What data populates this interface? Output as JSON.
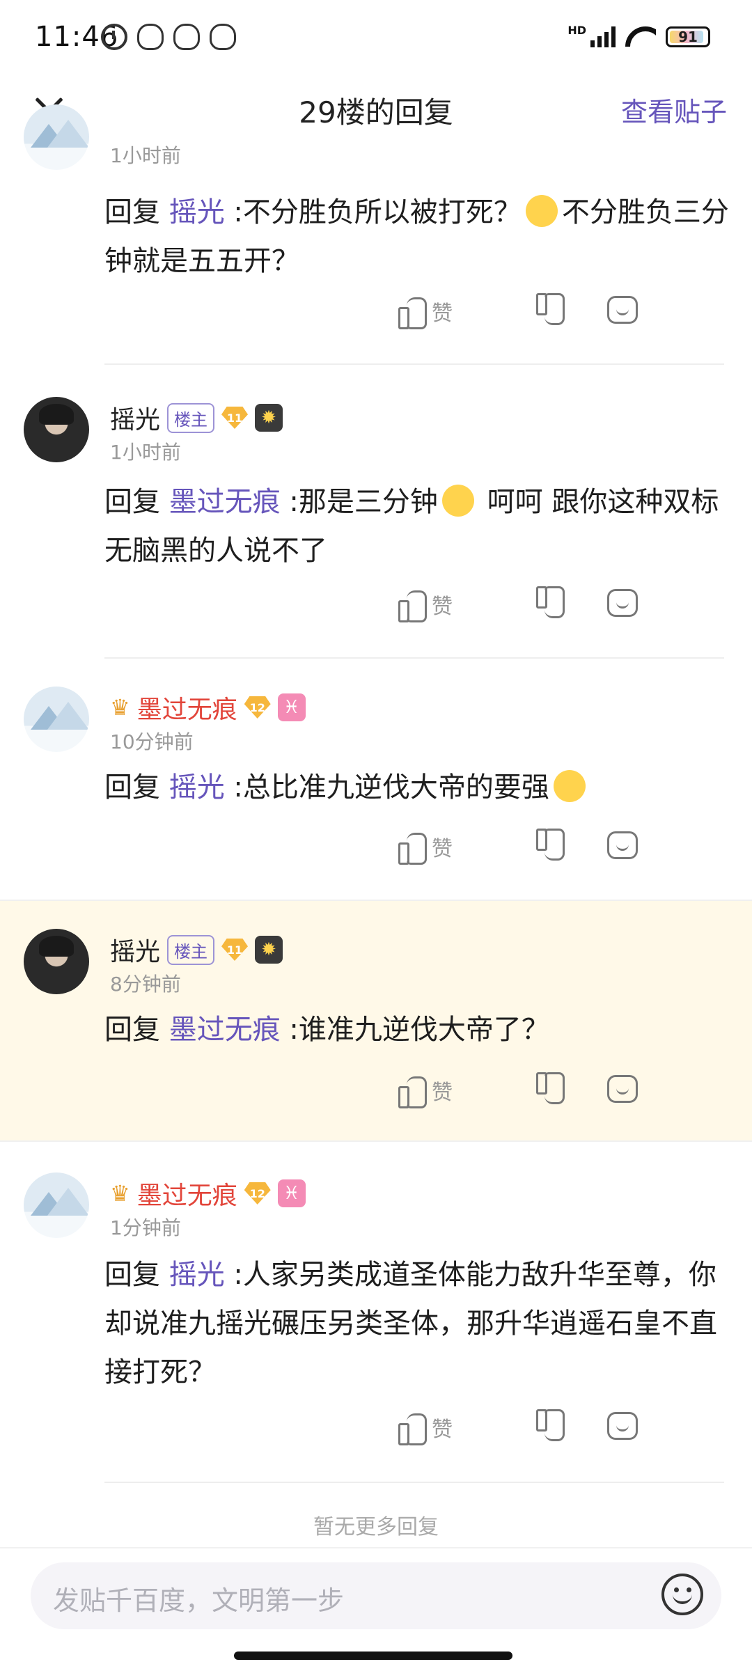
{
  "status_bar": {
    "time": "11:46",
    "network": "HD",
    "battery": "91"
  },
  "header": {
    "title": "29楼的回复",
    "view_post": "查看贴子"
  },
  "replies": [
    {
      "time": "1小时前",
      "prefix": "回复",
      "mention": "摇光",
      "text_a": " :不分胜负所以被打死？",
      "text_b": "不分胜负三分钟就是五五开？",
      "like": "赞"
    },
    {
      "name": "摇光",
      "role": "楼主",
      "level": "11",
      "time": "1小时前",
      "prefix": "回复",
      "mention": "墨过无痕",
      "text_a": " :那是三分钟",
      "text_b": " 呵呵 跟你这种双标无脑黑的人说不了",
      "like": "赞"
    },
    {
      "name": "墨过无痕",
      "level": "12",
      "time": "10分钟前",
      "prefix": "回复",
      "mention": "摇光",
      "text_a": " :总比准九逆伐大帝的要强",
      "like": "赞"
    },
    {
      "name": "摇光",
      "role": "楼主",
      "level": "11",
      "time": "8分钟前",
      "prefix": "回复",
      "mention": "墨过无痕",
      "text_a": " :谁准九逆伐大帝了？",
      "like": "赞"
    },
    {
      "name": "墨过无痕",
      "level": "12",
      "time": "1分钟前",
      "prefix": "回复",
      "mention": "摇光",
      "text_a": " :人家另类成道圣体能力敌升华至尊，你却说准九摇光碾压另类圣体，那升华逍遥石皇不直接打死？",
      "like": "赞"
    }
  ],
  "no_more": "暂无更多回复",
  "input": {
    "placeholder": "发贴千百度，文明第一步"
  },
  "colors": {
    "accent": "#6655bb",
    "highlight": "#fff9e8",
    "red_name": "#e2453a"
  }
}
